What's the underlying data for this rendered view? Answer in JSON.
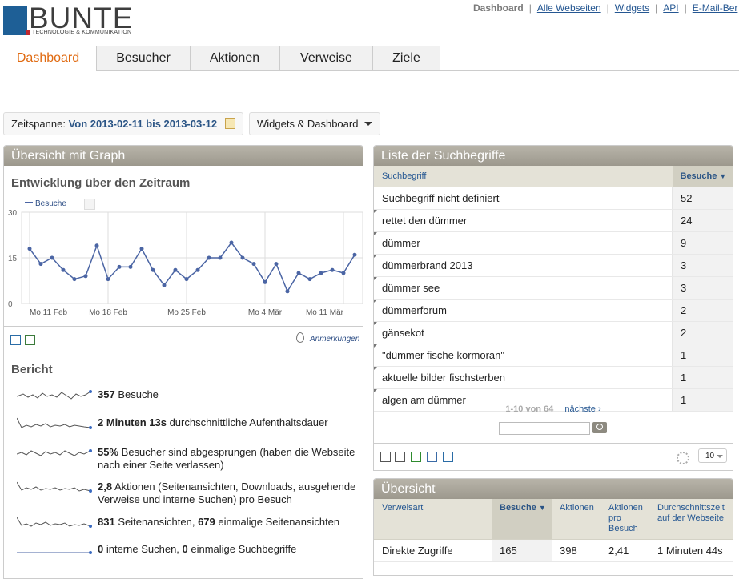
{
  "logo": {
    "word": "BUNTE",
    "tagline": "TECHNOLOGIE & KOMMUNIKATION"
  },
  "toplinks": {
    "current": "Dashboard",
    "links": [
      "Alle Webseiten",
      "Widgets",
      "API",
      "E-Mail-Ber"
    ]
  },
  "tabs": [
    "Dashboard",
    "Besucher",
    "Aktionen",
    "Verweise",
    "Ziele"
  ],
  "period": {
    "label": "Zeitspanne:",
    "value": "Von 2013-02-11 bis 2013-03-12"
  },
  "widgets_menu": "Widgets & Dashboard",
  "graph_widget": {
    "title": "Übersicht mit Graph",
    "chart_title": "Entwicklung über den Zeitraum",
    "legend": "Besuche",
    "annotations_label": "Anmerkungen",
    "chart_data": {
      "type": "line",
      "series": [
        {
          "name": "Besuche",
          "values": [
            18,
            13,
            15,
            11,
            8,
            9,
            19,
            8,
            12,
            12,
            18,
            11,
            6,
            11,
            8,
            11,
            15,
            15,
            20,
            15,
            13,
            7,
            13,
            4,
            10,
            8,
            10,
            11,
            10,
            16
          ]
        }
      ],
      "x_tick_labels": [
        "Mo 11 Feb",
        "Mo 18 Feb",
        "Mo 25 Feb",
        "Mo 4 Mär",
        "Mo 11 Mär"
      ],
      "x_tick_index": [
        0,
        7,
        14,
        21,
        28
      ],
      "y_ticks": [
        0,
        15,
        30
      ],
      "ylim": [
        0,
        30
      ],
      "grid": true
    }
  },
  "bericht": {
    "title": "Bericht",
    "rows": [
      {
        "b1": "357",
        "t1": " Besuche",
        "b2": "",
        "t2": ""
      },
      {
        "b1": "2 Minuten 13s",
        "t1": " durchschnittliche Aufenthaltsdauer",
        "b2": "",
        "t2": ""
      },
      {
        "b1": "55%",
        "t1": " Besucher sind abgesprungen (haben die Webseite nach einer Seite verlassen)",
        "b2": "",
        "t2": ""
      },
      {
        "b1": "2,8",
        "t1": " Aktionen (Seitenansichten, Downloads, ausgehende Verweise und interne Suchen) pro Besuch",
        "b2": "",
        "t2": ""
      },
      {
        "b1": "831",
        "t1": " Seitenansichten, ",
        "b2": "679",
        "t2": " einmalige Seitenansichten"
      },
      {
        "b1": "0",
        "t1": " interne Suchen, ",
        "b2": "0",
        "t2": " einmalige Suchbegriffe"
      }
    ]
  },
  "keywords_widget": {
    "title": "Liste der Suchbegriffe",
    "col_keyword": "Suchbegriff",
    "col_visits": "Besuche",
    "rows": [
      {
        "keyword": "Suchbegriff nicht definiert",
        "visits": "52"
      },
      {
        "keyword": "rettet den dümmer",
        "visits": "24"
      },
      {
        "keyword": "dümmer",
        "visits": "9"
      },
      {
        "keyword": "dümmerbrand 2013",
        "visits": "3"
      },
      {
        "keyword": "dümmer see",
        "visits": "3"
      },
      {
        "keyword": "dümmerforum",
        "visits": "2"
      },
      {
        "keyword": "gänsekot",
        "visits": "2"
      },
      {
        "keyword": "\"dümmer fische kormoran\"",
        "visits": "1"
      },
      {
        "keyword": "aktuelle bilder fischsterben",
        "visits": "1"
      },
      {
        "keyword": "algen am dümmer",
        "visits": "1"
      }
    ],
    "pager_current": "1-10 von 64",
    "pager_next": "nächste ›",
    "limit": "10"
  },
  "overview_widget": {
    "title": "Übersicht",
    "columns": [
      "Verweisart",
      "Besuche",
      "Aktionen",
      "Aktionen pro Besuch",
      "Durchschnittszeit auf der Webseite"
    ],
    "rows": [
      {
        "type": "Direkte Zugriffe",
        "visits": "165",
        "actions": "398",
        "per_visit": "2,41",
        "avg_time": "1 Minuten 44s"
      }
    ]
  },
  "colors": {
    "accent": "#e06a11",
    "link": "#255792",
    "header_bar": "#a8a499",
    "series": "#4b65a4"
  }
}
